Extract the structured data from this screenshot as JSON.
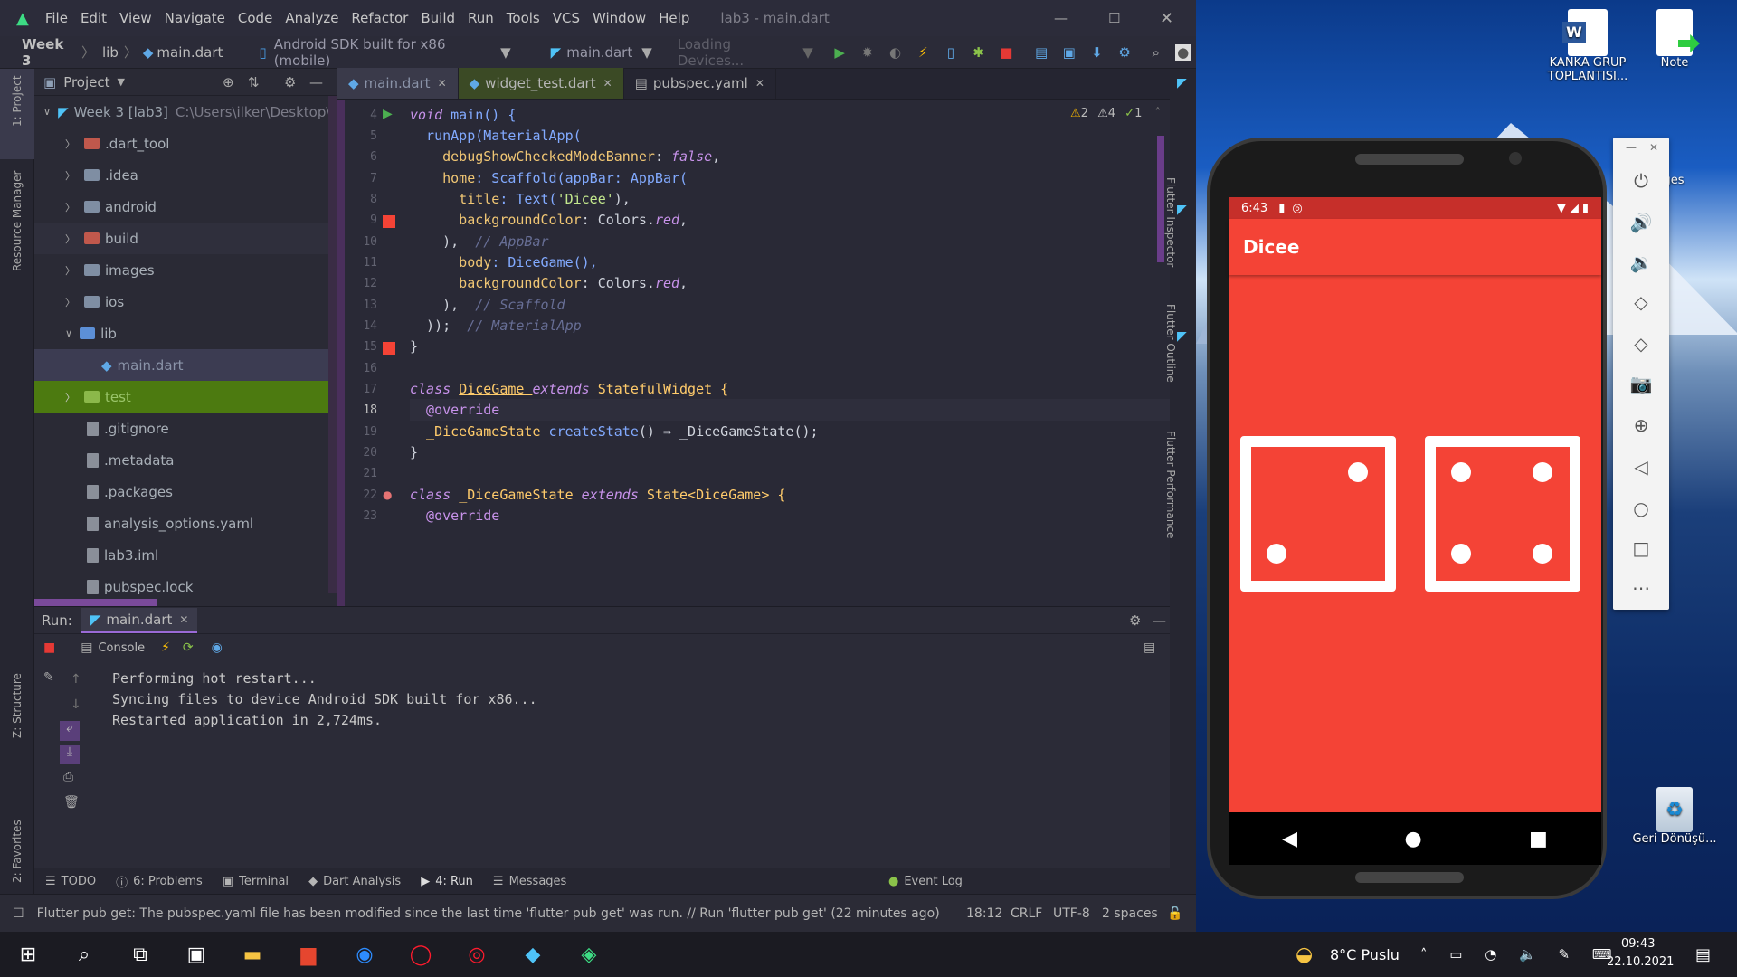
{
  "window": {
    "title": "lab3 - main.dart",
    "menu": [
      "File",
      "Edit",
      "View",
      "Navigate",
      "Code",
      "Analyze",
      "Refactor",
      "Build",
      "Run",
      "Tools",
      "VCS",
      "Window",
      "Help"
    ]
  },
  "breadcrumb": {
    "project": "Week 3",
    "folder": "lib",
    "file": "main.dart"
  },
  "toolbar": {
    "device": "Android SDK built for x86 (mobile)",
    "run_config": "main.dart",
    "devices_placeholder": "Loading Devices..."
  },
  "project_panel": {
    "title": "Project",
    "root": "Week 3 [lab3]",
    "root_path": "C:\\Users\\ilker\\Desktop\\Sch",
    "items": [
      ".dart_tool",
      ".idea",
      "android",
      "build",
      "images",
      "ios",
      "lib",
      "main.dart",
      "test",
      ".gitignore",
      ".metadata",
      ".packages",
      "analysis_options.yaml",
      "lab3.iml",
      "pubspec.lock"
    ]
  },
  "editor": {
    "tabs": [
      "main.dart",
      "widget_test.dart",
      "pubspec.yaml"
    ],
    "warnings": {
      "w1": "2",
      "w2": "4",
      "w3": "1"
    },
    "line_numbers": [
      "4",
      "5",
      "6",
      "7",
      "8",
      "9",
      "10",
      "11",
      "12",
      "13",
      "14",
      "15",
      "16",
      "17",
      "18",
      "19",
      "20",
      "21",
      "22",
      "23"
    ],
    "code": {
      "l4a": "void",
      "l4b": " main() {",
      "l5": "  runApp(MaterialApp(",
      "l6a": "    debugShowCheckedModeBanner",
      "l6b": ": ",
      "l6c": "false",
      ",l6d": ",",
      "l7a": "    home",
      "l7b": ": Scaffold(appBar: AppBar(",
      "l8a": "      title",
      "l8b": ": Text(",
      "l8c": "'Dicee'",
      "l8d": "),",
      "l9a": "      backgroundColor",
      "l9b": ": Colors.",
      "l9c": "red",
      ",l9d": ",",
      "l10a": "    ), ",
      "l10b": " // AppBar",
      "l11a": "      body",
      "l11b": ": DiceGame(),",
      "l12a": "      backgroundColor",
      "l12b": ": Colors.",
      "l12c": "red",
      ",l12d": ",",
      "l13a": "    ), ",
      "l13b": " // Scaffold",
      "l14a": "  )); ",
      "l14b": " // MaterialApp",
      "l15": "}",
      "l17a": "class ",
      "l17b": "DiceGame ",
      "l17c": "extends ",
      "l17d": "StatefulWidget {",
      "l18": "  @override",
      "l19a": "  _DiceGameState ",
      "l19b": "createState",
      "l19c": "() ⇒ _DiceGameState();",
      "l20": "}",
      "l22a": "class ",
      "l22b": "_DiceGameState ",
      "l22c": "extends ",
      "l22d": "State<DiceGame> {",
      "l23": "  @override"
    }
  },
  "run_panel": {
    "label": "Run:",
    "tab": "main.dart",
    "console_label": "Console",
    "lines": [
      "Performing hot restart...",
      "Syncing files to device Android SDK built for x86...",
      "Restarted application in 2,724ms."
    ]
  },
  "tool_windows": {
    "todo": "TODO",
    "problems": "6: Problems",
    "terminal": "Terminal",
    "dart_analysis": "Dart Analysis",
    "run": "4: Run",
    "messages": "Messages",
    "event_log": "Event Log"
  },
  "side_labels": {
    "project": "1: Project",
    "resource": "Resource Manager",
    "structure": "Z: Structure",
    "favorites": "2: Favorites",
    "inspector": "Flutter Inspector",
    "outline": "Flutter Outline",
    "performance": "Flutter Performance"
  },
  "status": {
    "message": "Flutter pub get: The pubspec.yaml file has been modified since the last time 'flutter pub get' was run. // Run 'flutter pub get' (22 minutes ago)",
    "position": "18:12",
    "line_sep": "CRLF",
    "encoding": "UTF-8",
    "indent": "2 spaces"
  },
  "phone": {
    "time": "6:43",
    "app_title": "Dicee",
    "left_die": 2,
    "right_die": 4,
    "bg_color": "#f44336"
  },
  "desktop": {
    "icon1": "KANKA GRUP TOPLANTISI...",
    "icon2": "Note",
    "icon3": "ages",
    "icon4": "Geri Dönüşü..."
  },
  "taskbar": {
    "weather": "8°C  Puslu",
    "time": "09:43",
    "date": "22.10.2021"
  }
}
